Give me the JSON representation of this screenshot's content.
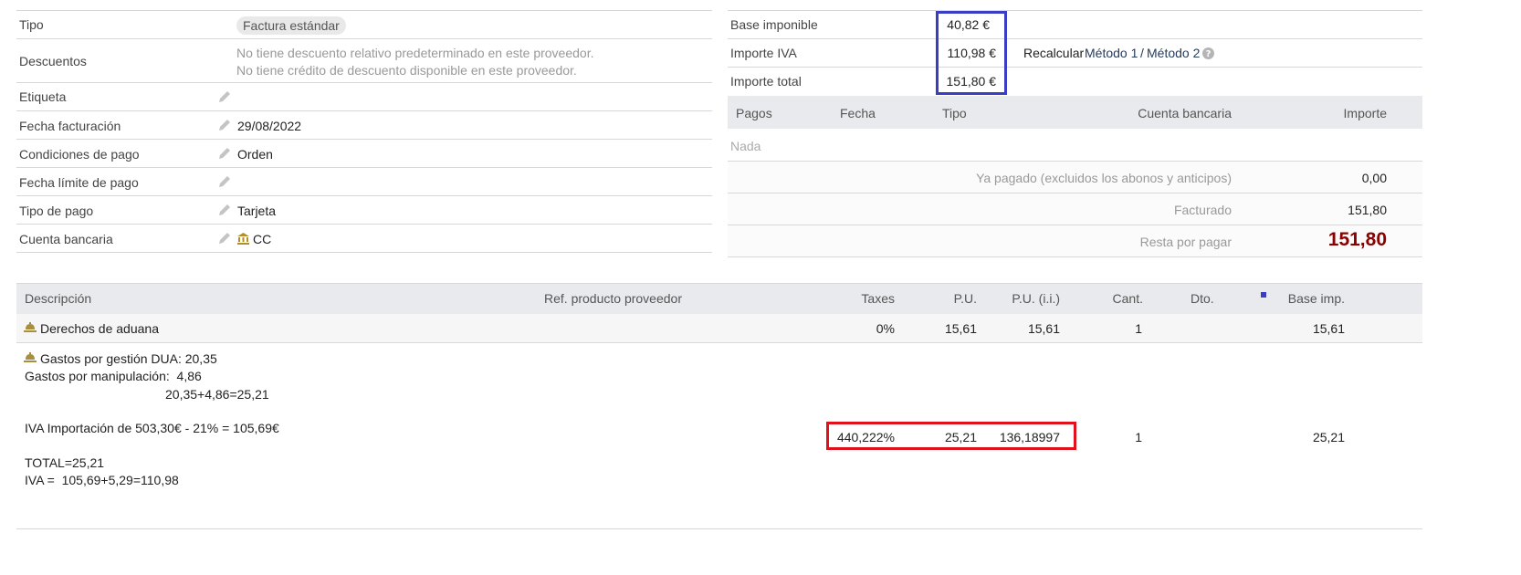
{
  "left_fields": [
    {
      "label": "Tipo",
      "value": "Factura estándar"
    },
    {
      "label": "Descuentos",
      "line1": "No tiene descuento relativo predeterminado en este proveedor.",
      "line2": "No tiene crédito de descuento disponible en este proveedor."
    },
    {
      "label": "Etiqueta",
      "value": ""
    },
    {
      "label": "Fecha facturación",
      "value": "29/08/2022"
    },
    {
      "label": "Condiciones de pago",
      "value": "Orden"
    },
    {
      "label": "Fecha límite de pago",
      "value": ""
    },
    {
      "label": "Tipo de pago",
      "value": "Tarjeta"
    },
    {
      "label": "Cuenta bancaria",
      "value": "CC"
    }
  ],
  "totals": {
    "base_label": "Base imponible",
    "base_value": "40,82 €",
    "iva_label": "Importe IVA",
    "iva_value": "110,98 €",
    "total_label": "Importe total",
    "total_value": "151,80 €",
    "recalc_label": "Recalcular",
    "method1": "Método 1",
    "sep": "/",
    "method2": "Método 2",
    "highlight_color": "#3a3ec4"
  },
  "payments": {
    "headers": [
      "Pagos",
      "Fecha",
      "Tipo",
      "Cuenta bancaria",
      "Importe"
    ],
    "empty": "Nada",
    "paid_label": "Ya pagado (excluidos los abonos y anticipos)",
    "paid_value": "0,00",
    "billed_label": "Facturado",
    "billed_value": "151,80",
    "remaining_label": "Resta por pagar",
    "remaining_value": "151,80",
    "remaining_color": "#8b0000"
  },
  "lines": {
    "headers": {
      "desc": "Descripción",
      "ref": "Ref. producto proveedor",
      "taxes": "Taxes",
      "pu": "P.U.",
      "pu_ii": "P.U. (i.i.)",
      "qty": "Cant.",
      "dto": "Dto.",
      "base": "Base imp."
    },
    "row1": {
      "desc": "Derechos de aduana",
      "taxes": "0%",
      "pu": "15,61",
      "pu_ii": "15,61",
      "qty": "1",
      "base": "15,61"
    },
    "row2": {
      "desc_lines": [
        "Gastos por gestión DUA: 20,35",
        "Gastos por manipulación:  4,86",
        "20,35+4,86=25,21",
        "IVA Importación de 503,30€ - 21% = 105,69€",
        "TOTAL=25,21",
        "IVA =  105,69+5,29=110,98"
      ],
      "taxes": "440,222%",
      "pu": "25,21",
      "pu_ii": "136,18997",
      "qty": "1",
      "base": "25,21",
      "highlight_color": "#e0111b"
    }
  }
}
